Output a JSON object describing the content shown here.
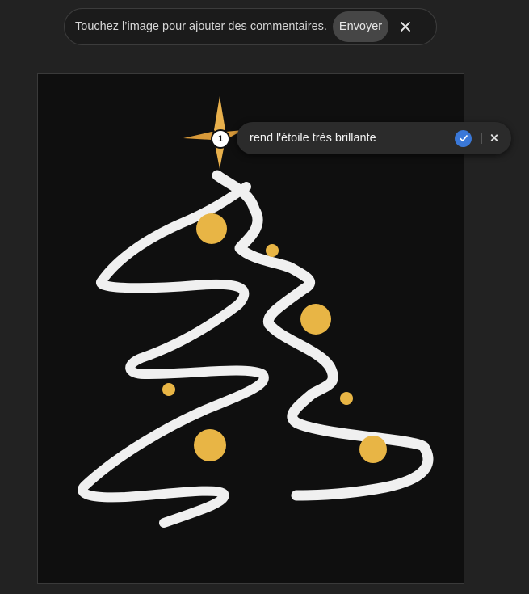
{
  "toolbar": {
    "hint": "Touchez l’image pour ajouter des commentaires.",
    "send_label": "Envoyer",
    "close_icon": "close-icon"
  },
  "annotation": {
    "pin_number": "1",
    "comment_text": "rend l'étoile très brillante",
    "confirm_icon": "checkmark-icon",
    "dismiss_icon": "close-icon",
    "accent_color": "#3a78d8"
  },
  "image": {
    "description_name": "christmas-tree-artwork",
    "star_color": "#e8b04c",
    "ornament_color": "#e8b545",
    "stroke_color": "#f0f0f0",
    "background_color": "#0f0f0f"
  }
}
